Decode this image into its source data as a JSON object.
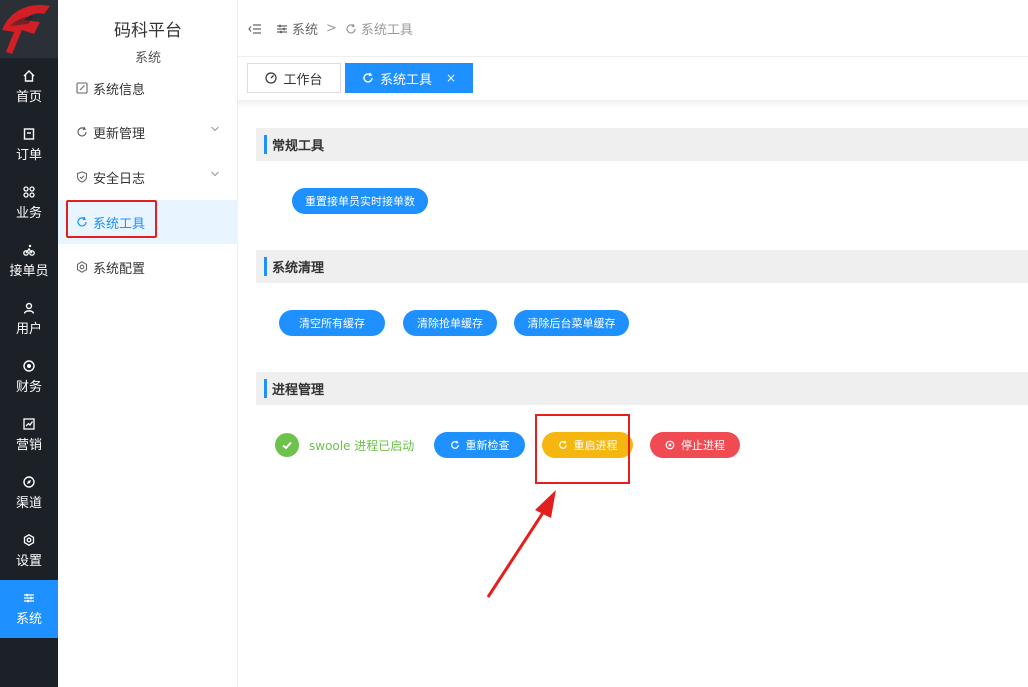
{
  "rail": {
    "items": [
      {
        "label": "首页",
        "icon": "home-icon"
      },
      {
        "label": "订单",
        "icon": "order-icon"
      },
      {
        "label": "业务",
        "icon": "command-icon"
      },
      {
        "label": "接单员",
        "icon": "rider-icon"
      },
      {
        "label": "用户",
        "icon": "user-icon"
      },
      {
        "label": "财务",
        "icon": "finance-icon"
      },
      {
        "label": "营销",
        "icon": "chart-icon"
      },
      {
        "label": "渠道",
        "icon": "compass-icon"
      },
      {
        "label": "设置",
        "icon": "settings-icon"
      },
      {
        "label": "系统",
        "icon": "sliders-icon",
        "active": true
      }
    ]
  },
  "sidebar": {
    "title": "码科平台",
    "subtitle": "系统",
    "items": [
      {
        "label": "系统信息",
        "icon": "edit-icon"
      },
      {
        "label": "更新管理",
        "icon": "refresh-icon",
        "expandable": true
      },
      {
        "label": "安全日志",
        "icon": "shield-icon",
        "expandable": true
      },
      {
        "label": "系统工具",
        "icon": "refresh-icon",
        "active": true
      },
      {
        "label": "系统配置",
        "icon": "settings-icon"
      }
    ]
  },
  "breadcrumb": {
    "items": [
      "系统",
      "系统工具"
    ],
    "separator": ">"
  },
  "tabs": [
    {
      "label": "工作台",
      "icon": "gauge-icon"
    },
    {
      "label": "系统工具",
      "icon": "refresh-icon",
      "active": true,
      "close": "×"
    }
  ],
  "sections": {
    "general": {
      "title": "常规工具",
      "buttons": [
        "重置接单员实时接单数"
      ]
    },
    "cleanup": {
      "title": "系统清理",
      "buttons": [
        "清空所有缓存",
        "清除抢单缓存",
        "清除后台菜单缓存"
      ]
    },
    "process": {
      "title": "进程管理",
      "status": "swoole 进程已启动",
      "buttons": {
        "recheck": "重新检查",
        "restart": "重启进程",
        "stop": "停止进程"
      }
    }
  },
  "colors": {
    "accent": "#1e90ff",
    "warning": "#f5b70f",
    "danger": "#f04b52",
    "success": "#6cc24a",
    "annotation": "#e31e1e"
  }
}
